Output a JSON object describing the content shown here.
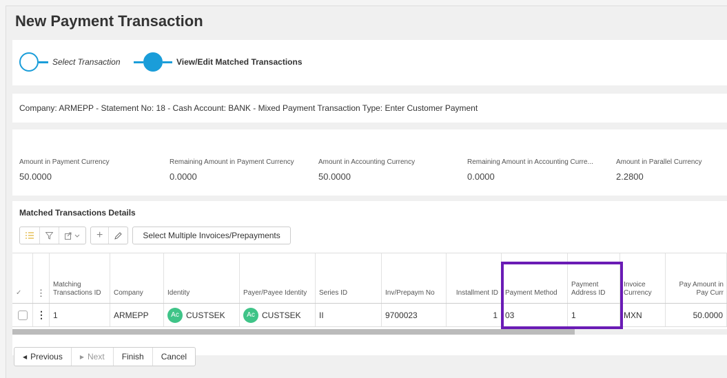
{
  "page": {
    "title": "New Payment Transaction"
  },
  "wizard": {
    "steps": [
      {
        "label": "Select Transaction"
      },
      {
        "label": "View/Edit Matched Transactions"
      }
    ]
  },
  "info": "Company: ARMEPP - Statement No: 18 - Cash Account: BANK - Mixed Payment Transaction Type: Enter Customer Payment",
  "amounts": [
    {
      "label": "Amount in Payment Currency",
      "value": "50.0000"
    },
    {
      "label": "Remaining Amount in Payment Currency",
      "value": "0.0000"
    },
    {
      "label": "Amount in Accounting Currency",
      "value": "50.0000"
    },
    {
      "label": "Remaining Amount in Accounting Curre...",
      "value": "0.0000"
    },
    {
      "label": "Amount in Parallel Currency",
      "value": "2.2800"
    }
  ],
  "details": {
    "title": "Matched Transactions Details",
    "select_multiple_label": "Select Multiple Invoices/Prepayments",
    "headers": {
      "check": "✓",
      "menu": "⋮",
      "matching_id": "Matching Transactions ID",
      "company": "Company",
      "identity": "Identity",
      "payer": "Payer/Payee Identity",
      "series": "Series ID",
      "inv": "Inv/Prepaym No",
      "installment": "Installment ID",
      "pay_method": "Payment Method",
      "pay_address": "Payment Address ID",
      "inv_currency": "Invoice Currency",
      "pay_amount": "Pay Amount in Pay Curr"
    },
    "row": {
      "menu": "⋮",
      "matching_id": "1",
      "company": "ARMEPP",
      "identity_avatar": "Ac",
      "identity": "CUSTSEK",
      "payer_avatar": "Ac",
      "payer": "CUSTSEK",
      "series": "II",
      "inv": "9700023",
      "installment": "1",
      "pay_method": "03",
      "pay_address": "1",
      "inv_currency": "MXN",
      "pay_amount": "50.0000"
    }
  },
  "nav": {
    "previous": "Previous",
    "next": "Next",
    "finish": "Finish",
    "cancel": "Cancel"
  },
  "colors": {
    "accent": "#1a9dd9",
    "highlight": "#6a1bb5",
    "avatar": "#3fc488"
  }
}
